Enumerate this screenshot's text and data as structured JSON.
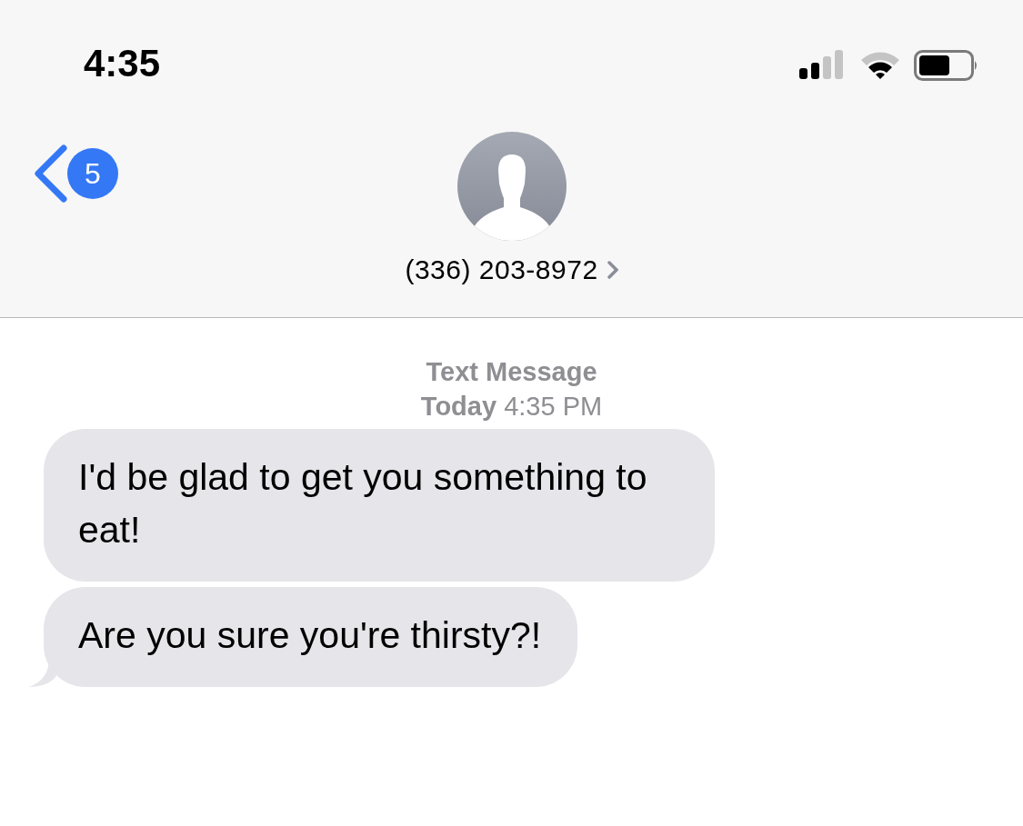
{
  "status_bar": {
    "time": "4:35"
  },
  "header": {
    "back_count": "5",
    "contact": "(336) 203-8972"
  },
  "conversation": {
    "service": "Text Message",
    "timestamp": "**Today** 4:35 PM",
    "messages": [
      {
        "text": "I'd be glad to get you something to eat!",
        "tail": false
      },
      {
        "text": "Are you sure you're thirsty?!",
        "tail": true
      }
    ]
  }
}
